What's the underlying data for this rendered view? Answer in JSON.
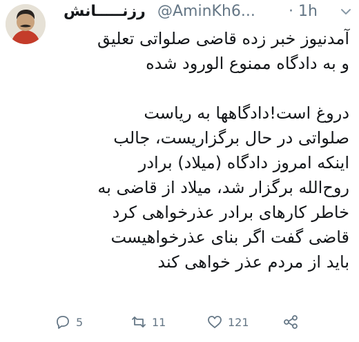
{
  "tweet": {
    "display_name": "رزنـــــانش",
    "handle": "@AminKh6...",
    "time": "· 1h",
    "text_lines_1": [
      "آمدنیوز خبر زده قاضی صلواتی تعلیق",
      "و به دادگاه ممنوع الورود شده"
    ],
    "text_lines_2": [
      "دروغ است!دادگاهها  به ریاست",
      "صلواتی در حال برگزاریست،  جالب",
      "اینکه امروز دادگاه (میلاد) برادر",
      "روح‌الله برگزار شد، میلاد از قاضی به",
      "خاطر کارهای برادر عذرخواهی کرد",
      "قاضی گفت اگر بنای عذرخواهیست",
      "باید از مردم عذر خواهی کند"
    ],
    "replies": "5",
    "retweets": "11",
    "likes": "121"
  },
  "icons": {
    "avatar": "user-avatar",
    "chevron": "chevron-down-icon",
    "reply": "reply-icon",
    "retweet": "retweet-icon",
    "like": "heart-icon",
    "share": "share-icon"
  },
  "colors": {
    "text": "#14171a",
    "muted": "#657786"
  }
}
